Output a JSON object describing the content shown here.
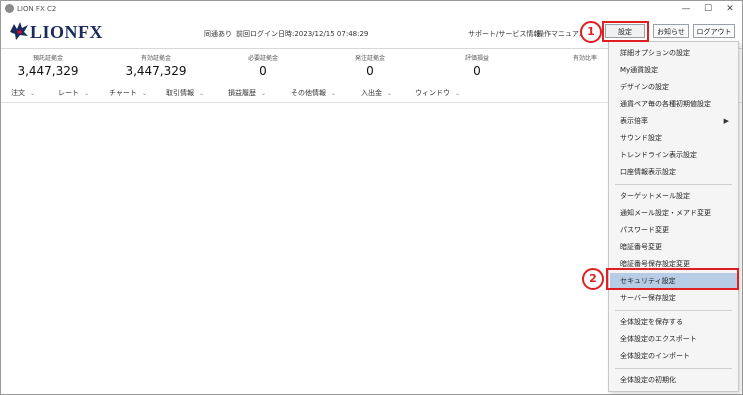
{
  "window": {
    "title": "LION FX C2",
    "minimize": "—",
    "maximize": "☐",
    "close": "✕"
  },
  "header": {
    "logo_text": "LIONFX",
    "comm_status": "同通あり",
    "last_login": "前回ログイン日時:2023/12/15 07:48:29",
    "support_link": "サポート/サービス情報",
    "manual_link": "操作マニュアル",
    "buttons": {
      "settings": "設定",
      "notice": "お知らせ",
      "logout": "ログアウト"
    }
  },
  "stats": [
    {
      "label": "預託証拠金",
      "value": "3,447,329"
    },
    {
      "label": "有効証拠金",
      "value": "3,447,329"
    },
    {
      "label": "必要証拠金",
      "value": "0"
    },
    {
      "label": "発注証拠金",
      "value": "0"
    },
    {
      "label": "評価損益",
      "value": "0"
    },
    {
      "label": "有効比率",
      "value": ""
    }
  ],
  "menubar": [
    "注文",
    "レート",
    "チャート",
    "取引情報",
    "損益履歴",
    "その他情報",
    "入出金",
    "ウィンドウ"
  ],
  "dropdown": {
    "group1": [
      "詳細オプションの設定",
      "My通貨設定",
      "デザインの設定",
      "通貨ペア毎の各種初期値設定",
      "表示倍率",
      "サウンド設定",
      "トレンドライン表示設定",
      "口座情報表示設定"
    ],
    "group2": [
      "ターゲットメール設定",
      "通知メール設定・メアド変更",
      "パスワード変更",
      "暗証番号変更",
      "暗証番号保存設定変更",
      "セキュリティ設定",
      "サーバー保存設定"
    ],
    "group3": [
      "全体設定を保存する",
      "全体設定のエクスポート",
      "全体設定のインポート"
    ],
    "group4": [
      "全体設定の初期化"
    ],
    "submenu_arrow": "▶",
    "highlighted": "セキュリティ設定"
  },
  "annotations": {
    "step1": "1",
    "step2": "2"
  },
  "colors": {
    "highlight": "#b7cde6",
    "annotation": "#e02020",
    "logo": "#1b2a5c"
  }
}
